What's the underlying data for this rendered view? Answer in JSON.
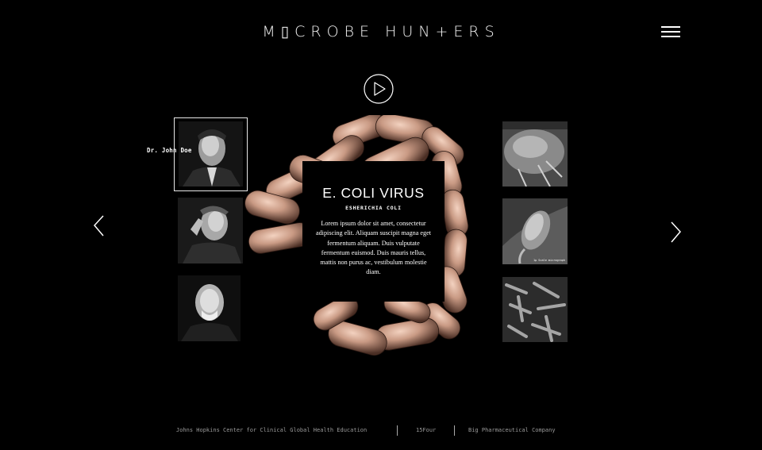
{
  "header": {
    "logo": "M▯CROBE HUN+ERS",
    "menu_icon": "hamburger-menu-icon",
    "play_icon": "play-icon"
  },
  "navigation": {
    "prev_icon": "chevron-left-icon",
    "next_icon": "chevron-right-icon"
  },
  "portraits": [
    {
      "label": "Dr. John Doe",
      "selected": true
    },
    {
      "label": ""
    },
    {
      "label": ""
    }
  ],
  "feature": {
    "title": "E. COLI VIRUS",
    "subtitle": "ESHERICHIA COLI",
    "body": "Lorem ipsum dolor sit amet, consectetur adipiscing elit. Aliquam suscipit magna eget fermentum aliquam. Duis vulputate fermentum euismod. Duis mauris tellus, mattis non purus ac, vestibulum molestie diam."
  },
  "thumbnails": [
    {
      "caption": ""
    },
    {
      "caption": "1μ Scale\nmicrograph"
    },
    {
      "caption": ""
    }
  ],
  "footer": {
    "links": [
      "Johns Hopkins Center for Clinical Global Health Education",
      "15Four",
      "Big Pharmaceutical Company"
    ]
  },
  "colors": {
    "background": "#000000",
    "microbe_tint": "#c9a08c",
    "footer_text": "#9a9a9a"
  }
}
